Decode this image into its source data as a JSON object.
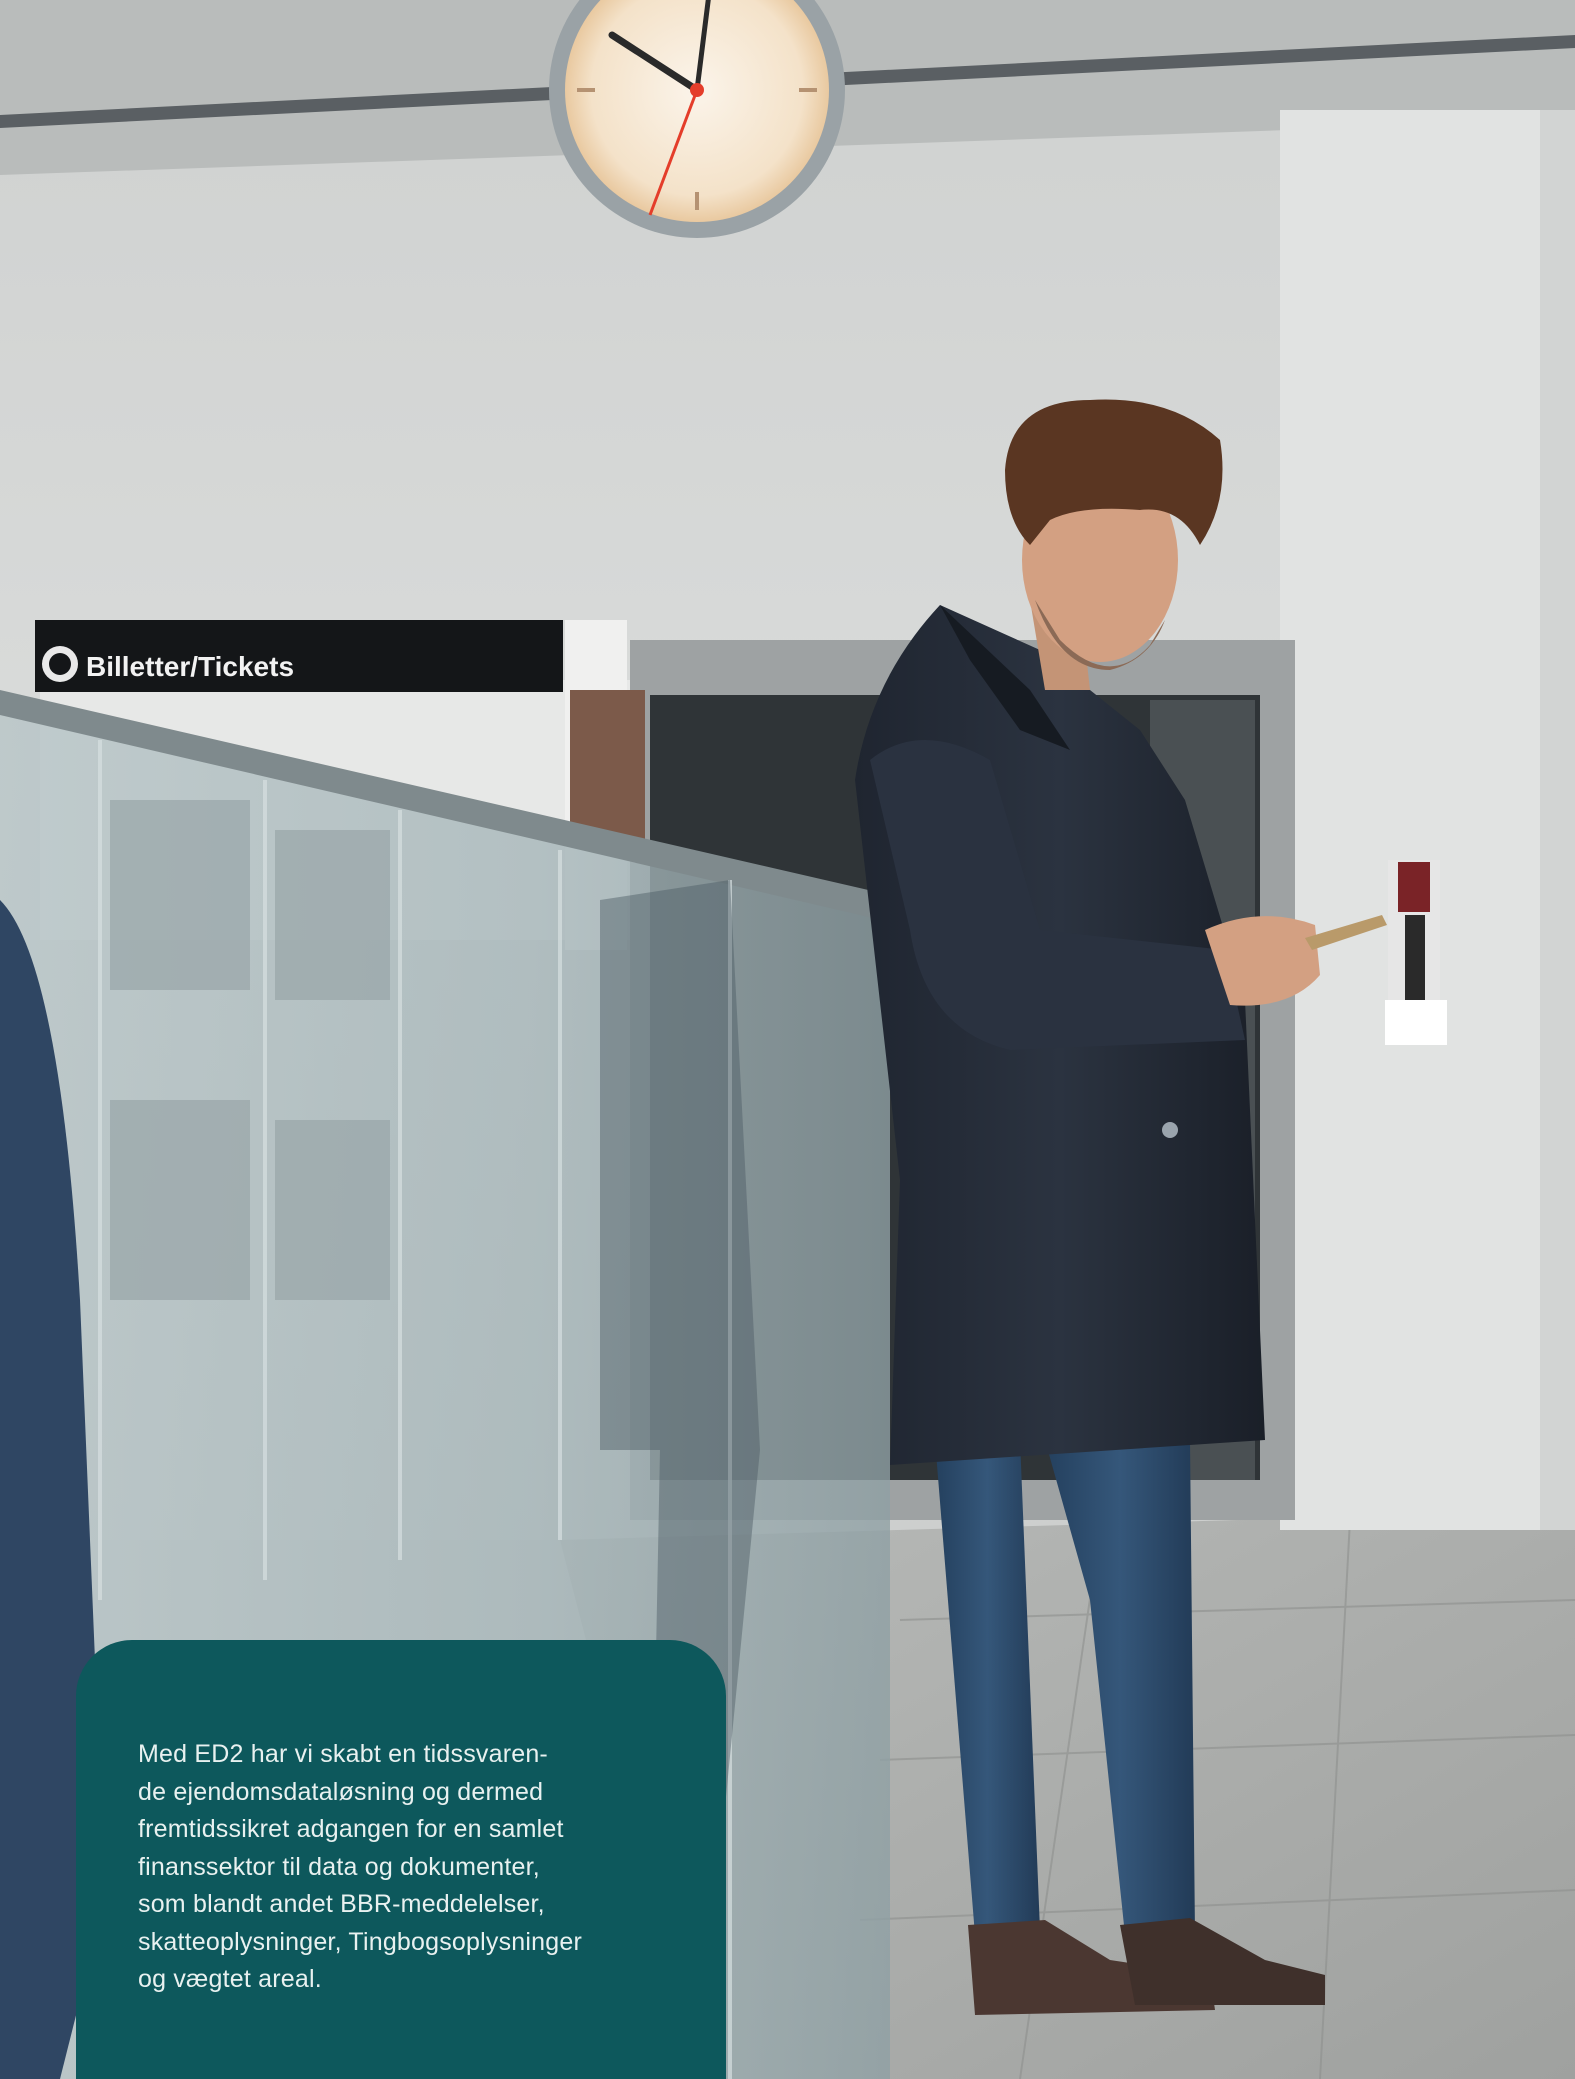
{
  "photo": {
    "sign_text": "Billetter/Tickets"
  },
  "caption": {
    "text": "Med ED2 har vi skabt en tidssvaren-\nde ejendomsdataløsning og dermed\nfremtidssikret adgangen for en samlet\nfinanssektor til data og dokumenter,\nsom blandt andet BBR-meddelelser,\nskatteoplysninger, Tingbogsoplysninger\nog vægtet areal."
  },
  "colors": {
    "caption_background": "#0d585c",
    "caption_text": "#e8f1f0",
    "wall": "#d6d8d7",
    "floor": "#a9aba9",
    "coat": "#262d38",
    "jeans": "#2c4b6b"
  }
}
